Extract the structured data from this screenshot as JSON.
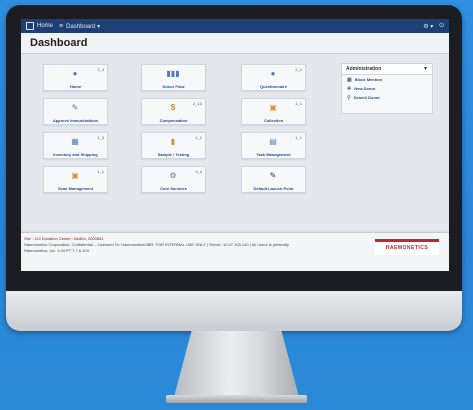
{
  "topbar": {
    "home": "Home",
    "dashboard": "Dashboard ▾",
    "right_icons": [
      "⚙ ▾",
      "⏻"
    ]
  },
  "page": {
    "title": "Dashboard"
  },
  "tiles": [
    {
      "label": "Home",
      "count": "2_4",
      "icon": "user-icon",
      "glyph": "👤"
    },
    {
      "label": "Donor Flow",
      "count": "",
      "icon": "donor-flow-icon",
      "glyph": "▮▮▮"
    },
    {
      "label": "Questionnaire",
      "count": "2_1",
      "icon": "questionnaire-icon",
      "glyph": "👤"
    },
    {
      "label": "Approve Immunizations",
      "count": "",
      "icon": "syringe-icon",
      "glyph": "✎"
    },
    {
      "label": "Compensation",
      "count": "2_10",
      "icon": "dollar-icon",
      "glyph": "$"
    },
    {
      "label": "Collection",
      "count": "1_1",
      "icon": "collection-icon",
      "glyph": "▣"
    },
    {
      "label": "Inventory and Shipping",
      "count": "1_3",
      "icon": "inventory-icon",
      "glyph": "▦"
    },
    {
      "label": "Sample / Testing",
      "count": "1_1",
      "icon": "sample-icon",
      "glyph": "⚗"
    },
    {
      "label": "Task Management",
      "count": "1_1",
      "icon": "task-icon",
      "glyph": "▤"
    },
    {
      "label": "Scan Management",
      "count": "1_1",
      "icon": "scan-icon",
      "glyph": "▣"
    },
    {
      "label": "Core Services",
      "count": "3_4",
      "icon": "gear-icon",
      "glyph": "⚙"
    },
    {
      "label": "Default Launch Point",
      "count": "",
      "icon": "edit-icon",
      "glyph": "✎"
    }
  ],
  "admin": {
    "header": "Administration",
    "items": [
      "Block Mention",
      "New Donor",
      "Search Donor"
    ]
  },
  "footer": {
    "line1": "Site : 119   Donation Center : Bedfor, 2000851",
    "line2": "Haemonetics Corporation, Confidential -- Licensed To: Haemonetics/3BR. FOR INTERNAL USE ONLY  |  Server: 10.97.103.140  |  All Users is presently ",
    "line3": "Haemonetics, Inc. 1:04 PT 7.7.6.104",
    "logo": "HAEMONETICS"
  }
}
